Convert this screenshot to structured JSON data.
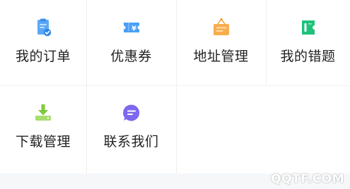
{
  "menu": {
    "items": [
      {
        "label": "我的订单",
        "icon": "clipboard-check-icon",
        "color": "#4a9ff5"
      },
      {
        "label": "优惠券",
        "icon": "coupon-ticket-icon",
        "color": "#4a9ff5"
      },
      {
        "label": "地址管理",
        "icon": "address-sign-icon",
        "color": "#f7a23b"
      },
      {
        "label": "我的错题",
        "icon": "error-book-icon",
        "color": "#20c67a"
      },
      {
        "label": "下载管理",
        "icon": "download-icon",
        "color": "#8cd24a"
      },
      {
        "label": "联系我们",
        "icon": "chat-bubble-icon",
        "color": "#7e6cf0"
      }
    ]
  },
  "coupon_symbol": "¥",
  "watermark": "QQTF.COM"
}
